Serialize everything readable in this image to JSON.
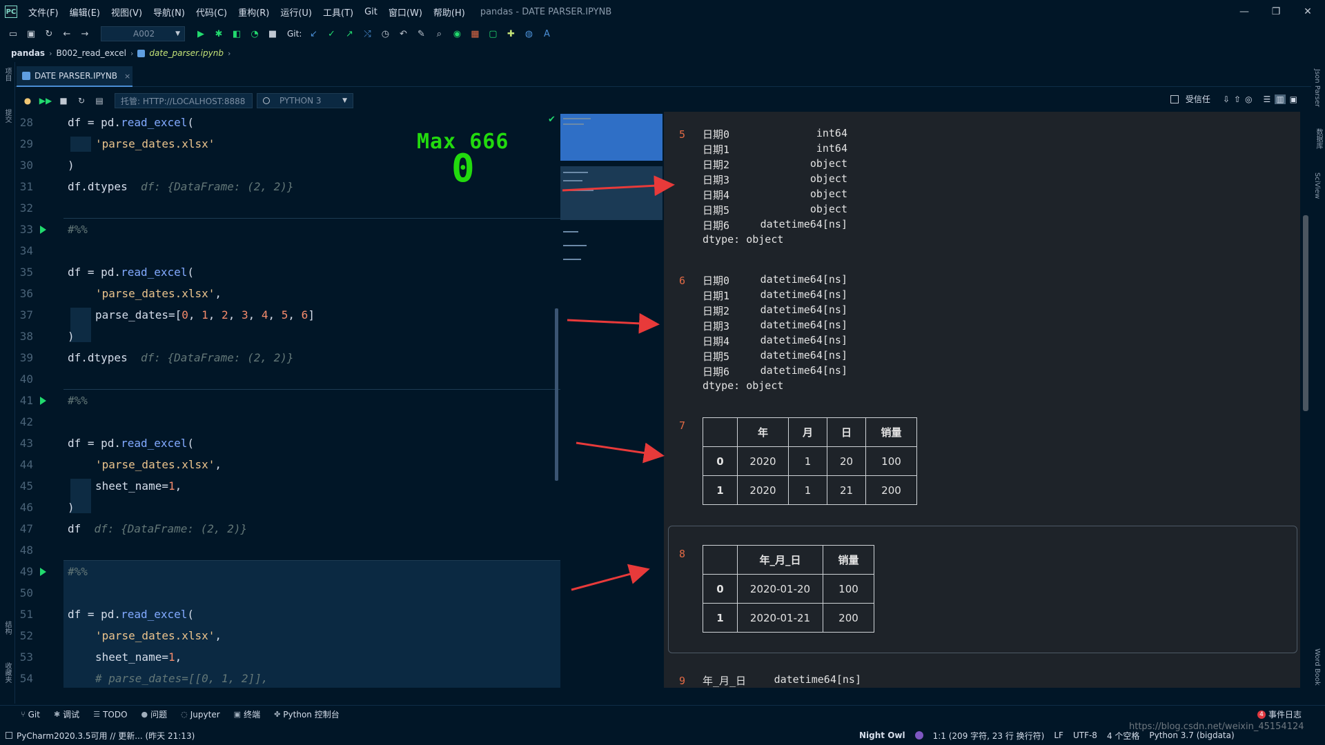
{
  "window": {
    "logo": "PC",
    "menus": [
      "文件(F)",
      "编辑(E)",
      "视图(V)",
      "导航(N)",
      "代码(C)",
      "重构(R)",
      "运行(U)",
      "工具(T)",
      "Git",
      "窗口(W)",
      "帮助(H)"
    ],
    "title": "pandas - DATE PARSER.IPYNB",
    "controls": {
      "minimize": "—",
      "restore": "❐",
      "close": "✕"
    }
  },
  "toolbar": {
    "run_config": "A002",
    "git_label": "Git:"
  },
  "breadcrumb": {
    "project": "pandas",
    "folder": "B002_read_excel",
    "file": "date_parser.ipynb"
  },
  "tab": {
    "label": "DATE PARSER.IPYNB",
    "close": "×"
  },
  "notebook_bar": {
    "server": "托管: HTTP://LOCALHOST:8888",
    "kernel": "PYTHON 3",
    "trusted": "受信任"
  },
  "editor": {
    "line_numbers": [
      "28",
      "29",
      "30",
      "31",
      "32",
      "33",
      "34",
      "35",
      "36",
      "37",
      "38",
      "39",
      "40",
      "41",
      "42",
      "43",
      "44",
      "45",
      "46",
      "47",
      "48",
      "49",
      "50",
      "51",
      "52",
      "53",
      "54"
    ],
    "lines": {
      "l28_a": "df = pd.",
      "l28_fn": "read_excel",
      "l28_b": "(",
      "l29": "'parse_dates.xlsx'",
      "l30": ")",
      "l31": "df.dtypes",
      "l31_hint": "df: {DataFrame: (2, 2)}",
      "l33": "#%%",
      "l35_a": "df = pd.",
      "l35_fn": "read_excel",
      "l35_b": "(",
      "l36_str": "'parse_dates.xlsx'",
      "l36_c": ",",
      "l37_a": "parse_dates=[",
      "l37_n0": "0",
      "l37_n1": "1",
      "l37_n2": "2",
      "l37_n3": "3",
      "l37_n4": "4",
      "l37_n5": "5",
      "l37_n6": "6",
      "l37_b": "]",
      "l38": ")",
      "l39": "df.dtypes",
      "l39_hint": "df: {DataFrame: (2, 2)}",
      "l41": "#%%",
      "l43_a": "df = pd.",
      "l43_fn": "read_excel",
      "l43_b": "(",
      "l44_str": "'parse_dates.xlsx'",
      "l44_c": ",",
      "l45_a": "sheet_name=",
      "l45_n": "1",
      "l45_c": ",",
      "l46": ")",
      "l47": "df",
      "l47_hint": "df: {DataFrame: (2, 2)}",
      "l49": "#%%",
      "l51_a": "df = pd.",
      "l51_fn": "read_excel",
      "l51_b": "(",
      "l52_str": "'parse_dates.xlsx'",
      "l52_c": ",",
      "l53_a": "sheet_name=",
      "l53_n": "1",
      "l53_c": ",",
      "l54": "# parse_dates=[[0, 1, 2]],"
    },
    "overlay_text": "Max 666",
    "overlay_big": "0"
  },
  "output": {
    "out5": {
      "num": "5",
      "rows": [
        {
          "k": "日期0",
          "v": "int64"
        },
        {
          "k": "日期1",
          "v": "int64"
        },
        {
          "k": "日期2",
          "v": "object"
        },
        {
          "k": "日期3",
          "v": "object"
        },
        {
          "k": "日期4",
          "v": "object"
        },
        {
          "k": "日期5",
          "v": "object"
        },
        {
          "k": "日期6",
          "v": "datetime64[ns]"
        }
      ],
      "footer": "dtype: object"
    },
    "out6": {
      "num": "6",
      "rows": [
        {
          "k": "日期0",
          "v": "datetime64[ns]"
        },
        {
          "k": "日期1",
          "v": "datetime64[ns]"
        },
        {
          "k": "日期2",
          "v": "datetime64[ns]"
        },
        {
          "k": "日期3",
          "v": "datetime64[ns]"
        },
        {
          "k": "日期4",
          "v": "datetime64[ns]"
        },
        {
          "k": "日期5",
          "v": "datetime64[ns]"
        },
        {
          "k": "日期6",
          "v": "datetime64[ns]"
        }
      ],
      "footer": "dtype: object"
    },
    "out7": {
      "num": "7",
      "headers": [
        "",
        "年",
        "月",
        "日",
        "销量"
      ],
      "rows": [
        [
          "0",
          "2020",
          "1",
          "20",
          "100"
        ],
        [
          "1",
          "2020",
          "1",
          "21",
          "200"
        ]
      ]
    },
    "out8": {
      "num": "8",
      "headers": [
        "",
        "年_月_日",
        "销量"
      ],
      "rows": [
        [
          "0",
          "2020-01-20",
          "100"
        ],
        [
          "1",
          "2020-01-21",
          "200"
        ]
      ]
    },
    "out9": {
      "num": "9",
      "k": "年_月_日",
      "v": "datetime64[ns]"
    }
  },
  "side_labels": {
    "left_top": "项目",
    "left_commit": "提交",
    "left_structure": "结构",
    "left_favorites": "收藏夹",
    "right_json": "Json Parser",
    "right_db": "数据库",
    "right_sciview": "SciView",
    "right_wordbook": "Word Book"
  },
  "bottom_tabs": [
    "Git",
    "调试",
    "TODO",
    "问题",
    "Jupyter",
    "终端",
    "Python 控制台"
  ],
  "event_log": {
    "badge": "4",
    "label": "事件日志"
  },
  "statusbar": {
    "left": "PyCharm2020.3.5可用 // 更新... (昨天 21:13)",
    "theme": "Night Owl",
    "position": "1:1 (209 字符, 23 行 换行符)",
    "line_sep": "LF",
    "encoding": "UTF-8",
    "indent": "4 个空格",
    "interpreter": "Python 3.7 (bigdata)",
    "watermark": "https://blog.csdn.net/weixin_45154124"
  },
  "colors": {
    "accent": "#4b8fd6",
    "arrow": "#e83a3a",
    "overlay": "#22da0e",
    "output_index": "#e36a45"
  }
}
